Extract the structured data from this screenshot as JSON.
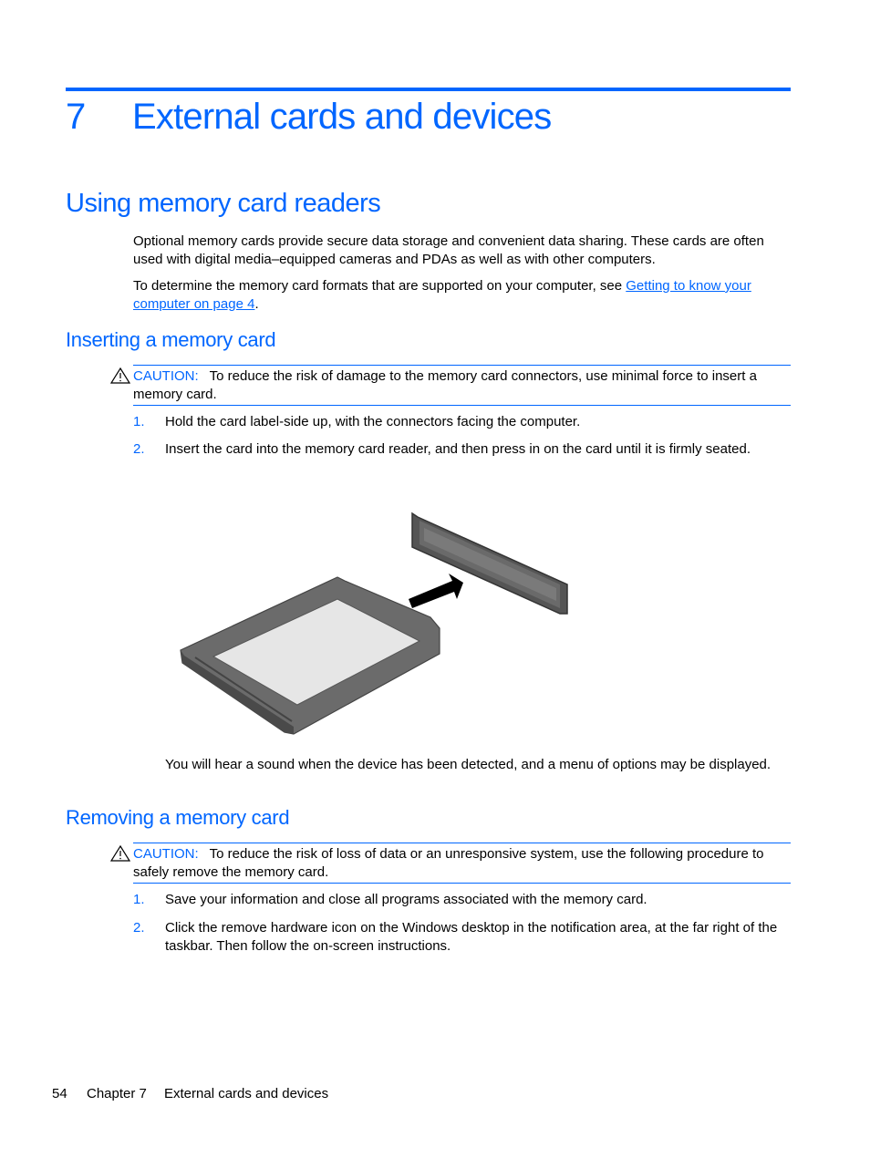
{
  "chapter": {
    "number": "7",
    "title": "External cards and devices"
  },
  "section": {
    "title": "Using memory card readers",
    "paragraphs": [
      "Optional memory cards provide secure data storage and convenient data sharing. These cards are often used with digital media–equipped cameras and PDAs as well as with other computers."
    ],
    "formats_para": {
      "prefix": "To determine the memory card formats that are supported on your computer, see ",
      "link_text": "Getting to know your computer on page 4",
      "suffix": "."
    }
  },
  "inserting": {
    "title": "Inserting a memory card",
    "caution": {
      "icon": "warning-triangle-icon",
      "label": "CAUTION:",
      "text": "To reduce the risk of damage to the memory card connectors, use minimal force to insert a memory card."
    },
    "steps": [
      {
        "num": "1.",
        "text": "Hold the card label-side up, with the connectors facing the computer."
      },
      {
        "num": "2.",
        "text": "Insert the card into the memory card reader, and then press in on the card until it is firmly seated."
      }
    ],
    "figure": {
      "description": "Illustration: memory card being inserted into card reader slot",
      "arrow": "insert-direction-arrow"
    },
    "after_text": "You will hear a sound when the device has been detected, and a menu of options may be displayed."
  },
  "removing": {
    "title": "Removing a memory card",
    "caution": {
      "icon": "warning-triangle-icon",
      "label": "CAUTION:",
      "text": "To reduce the risk of loss of data or an unresponsive system, use the following procedure to safely remove the memory card."
    },
    "steps": [
      {
        "num": "1.",
        "text": "Save your information and close all programs associated with the memory card."
      },
      {
        "num": "2.",
        "text": "Click the remove hardware icon on the Windows desktop in the notification area, at the far right of the taskbar. Then follow the on-screen instructions."
      }
    ]
  },
  "footer": {
    "page_number": "54",
    "chapter_label": "Chapter 7",
    "chapter_title": "External cards and devices"
  },
  "colors": {
    "accent": "#0066ff",
    "text": "#000000"
  }
}
